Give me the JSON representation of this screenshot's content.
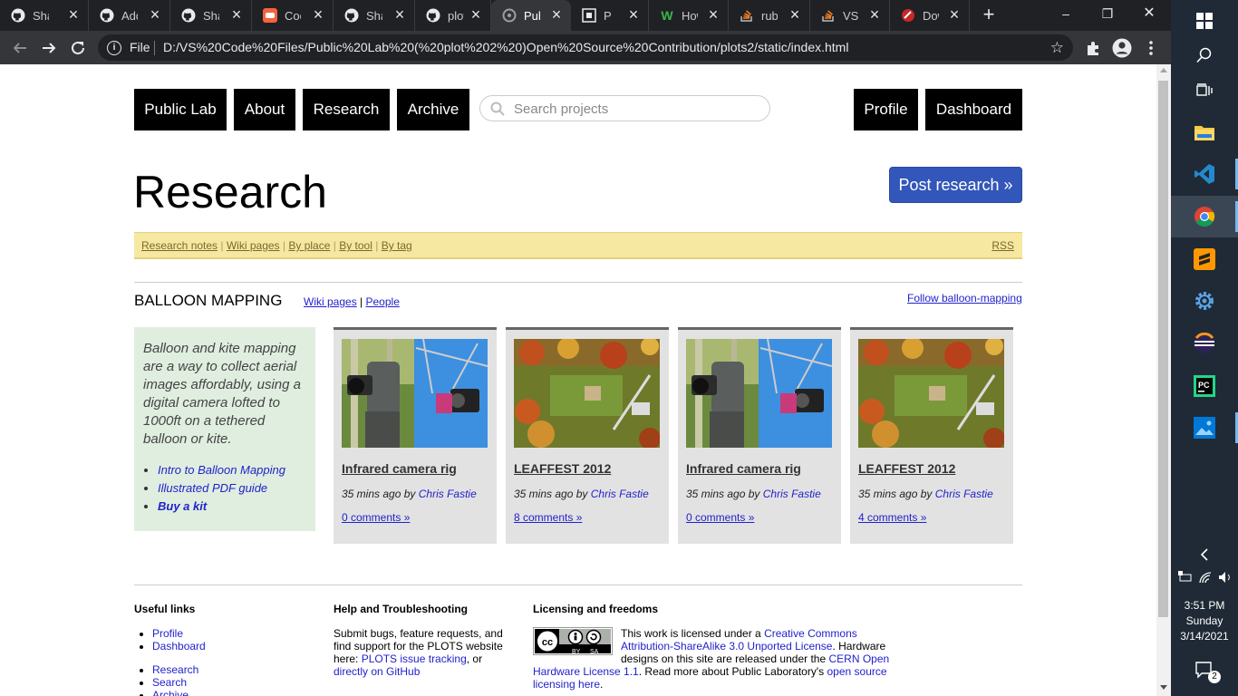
{
  "browser": {
    "tabs": [
      {
        "title": "Shar",
        "icon": "github-icon"
      },
      {
        "title": "Addi",
        "icon": "github-icon"
      },
      {
        "title": "Shar",
        "icon": "github-icon"
      },
      {
        "title": "Codi",
        "icon": "codingame-icon"
      },
      {
        "title": "Shar",
        "icon": "github-icon"
      },
      {
        "title": "plot",
        "icon": "github-icon"
      },
      {
        "title": "Publ",
        "icon": "globe-icon",
        "active": true
      },
      {
        "title": "P",
        "icon": "qr-icon"
      },
      {
        "title": "How",
        "icon": "w-icon"
      },
      {
        "title": "ruby",
        "icon": "stackoverflow-icon"
      },
      {
        "title": "VSC",
        "icon": "stackoverflow-icon"
      },
      {
        "title": "Dow",
        "icon": "red-icon"
      }
    ],
    "new_tab": "+",
    "window_controls": {
      "minimize": "–",
      "maximize": "❐",
      "close": "✕"
    },
    "address": {
      "scheme_label": "File",
      "url": "D:/VS%20Code%20Files/Public%20Lab%20(%20plot%202%20)Open%20Source%20Contribution/plots2/static/index.html"
    }
  },
  "nav": {
    "public_lab": "Public Lab",
    "about": "About",
    "research": "Research",
    "archive": "Archive",
    "search_placeholder": "Search projects",
    "profile": "Profile",
    "dashboard": "Dashboard"
  },
  "heading": "Research",
  "post_button": "Post research »",
  "subnav": {
    "links": [
      "Research notes",
      "Wiki pages",
      "By place",
      "By tool",
      "By tag"
    ],
    "separator": "|",
    "rss": "RSS"
  },
  "section": {
    "title": "BALLOON MAPPING",
    "wiki_link": "Wiki pages",
    "sep": "|",
    "people_link": "People",
    "follow": "Follow balloon-mapping"
  },
  "info": {
    "description": "Balloon and kite mapping are a way to collect aerial images affordably, using a digital camera lofted to 1000ft on a tethered balloon or kite.",
    "links": [
      "Intro to Balloon Mapping",
      "Illustrated PDF guide",
      "Buy a kit"
    ]
  },
  "cards": [
    {
      "title": "Infrared camera rig",
      "time": "35 mins ago by",
      "author": "Chris Fastie",
      "comments": "0 comments »",
      "image": "camera-rig"
    },
    {
      "title": "LEAFFEST 2012",
      "time": "35 mins ago by",
      "author": "Chris Fastie",
      "comments": "8 comments »",
      "image": "aerial"
    },
    {
      "title": "Infrared camera rig",
      "time": "35 mins ago by",
      "author": "Chris Fastie",
      "comments": "0 comments »",
      "image": "camera-rig"
    },
    {
      "title": "LEAFFEST 2012",
      "time": "35 mins ago by",
      "author": "Chris Fastie",
      "comments": "4 comments »",
      "image": "aerial"
    }
  ],
  "footer": {
    "useful": {
      "heading": "Useful links",
      "links1": [
        "Profile",
        "Dashboard"
      ],
      "links2": [
        "Research",
        "Search",
        "Archive"
      ]
    },
    "help": {
      "heading": "Help and Troubleshooting",
      "text": "Submit bugs, feature requests, and find support for the PLOTS website here:",
      "link1": "PLOTS issue tracking",
      "or": ", or",
      "link2": "directly on GitHub"
    },
    "license": {
      "heading": "Licensing and freedoms",
      "t1": "This work is licensed under a ",
      "l1": "Creative Commons Attribution-ShareAlike 3.0 Unported License",
      "t2": ". Hardware designs on this site are released under the ",
      "l2": "CERN Open Hardware License 1.1",
      "t3": ". Read more about Public Laboratory's ",
      "l3": "open source licensing here",
      "t4": ".",
      "badge_by": "BY",
      "badge_sa": "SA"
    }
  },
  "taskbar": {
    "time": "3:51 PM",
    "day": "Sunday",
    "date": "3/14/2021",
    "notifications": "2"
  }
}
